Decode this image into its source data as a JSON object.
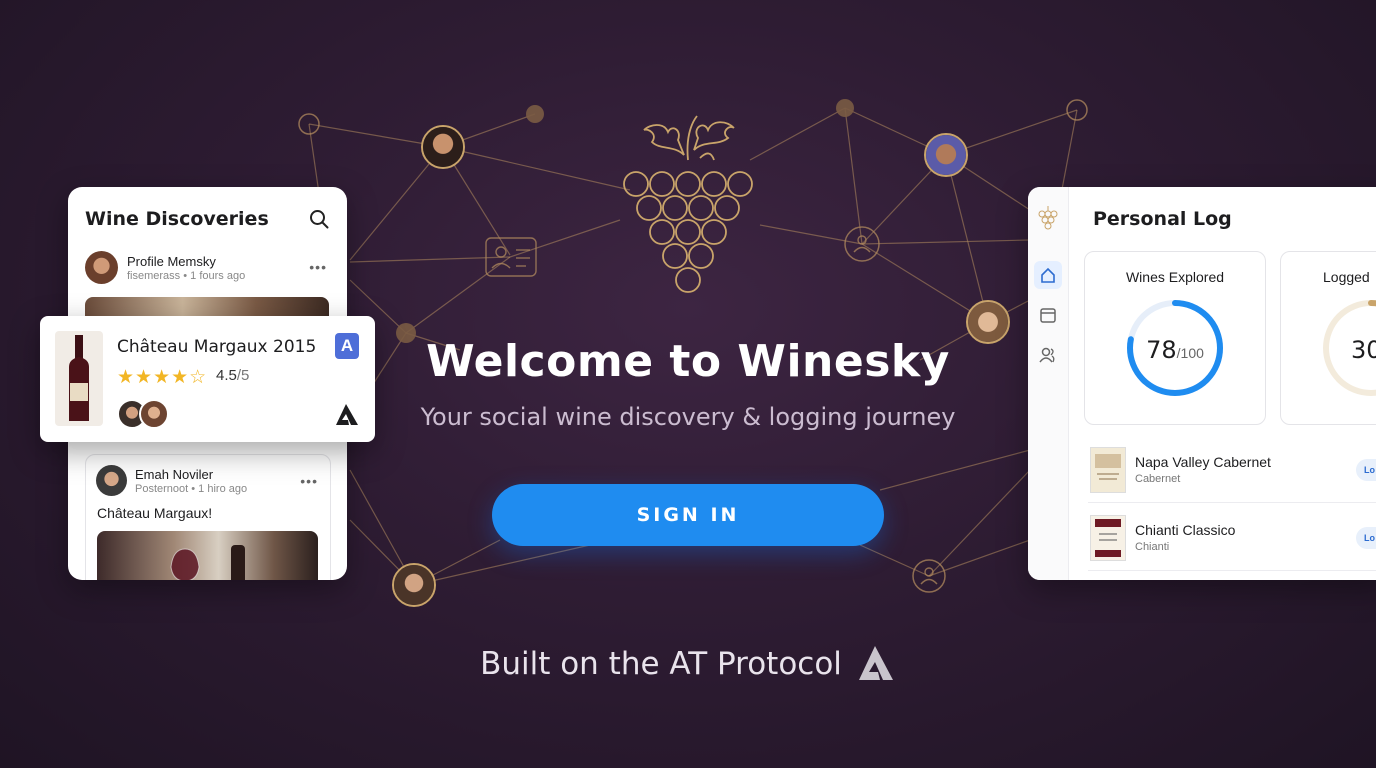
{
  "hero": {
    "title": "Welcome to Winesky",
    "subtitle": "Your social wine discovery & logging journey",
    "sign_in_label": "SIGN IN"
  },
  "footer": {
    "text": "Built on the AT Protocol",
    "logo_icon": "at-protocol-icon"
  },
  "brand": {
    "logo_icon": "grape-cluster-icon",
    "accent": "#c9a46a",
    "button_color": "#1f8cf0"
  },
  "discoveries": {
    "title": "Wine Discoveries",
    "search_icon": "search-icon",
    "posts": [
      {
        "name": "Profile Memsky",
        "meta": "fisemerass • 1 fours ago"
      },
      {
        "name": "Emah Noviler",
        "meta": "Posternoot • 1 hiro ago",
        "caption": "Château Margaux!"
      }
    ]
  },
  "featured_wine": {
    "name": "Château Margaux 2015",
    "stars": "★★★★☆",
    "rating": "4.5",
    "rating_max": "/5",
    "rating_fraction": 0.9,
    "badge": "A"
  },
  "personal_log": {
    "title": "Personal Log",
    "stats": [
      {
        "label": "Wines Explored",
        "value": "78",
        "max": "/100",
        "fraction": 0.78,
        "color": "#1f8cf0"
      },
      {
        "label": "Logged",
        "value": "30",
        "fraction": 0.3,
        "color": "#c9a46a"
      }
    ],
    "entries": [
      {
        "name": "Napa Valley Cabernet",
        "type": "Cabernet",
        "badge": "Lo"
      },
      {
        "name": "Chianti Classico",
        "type": "Chianti",
        "badge": "Lo"
      }
    ],
    "rail_icons": [
      "home-icon",
      "calendar-icon",
      "people-icon"
    ]
  }
}
